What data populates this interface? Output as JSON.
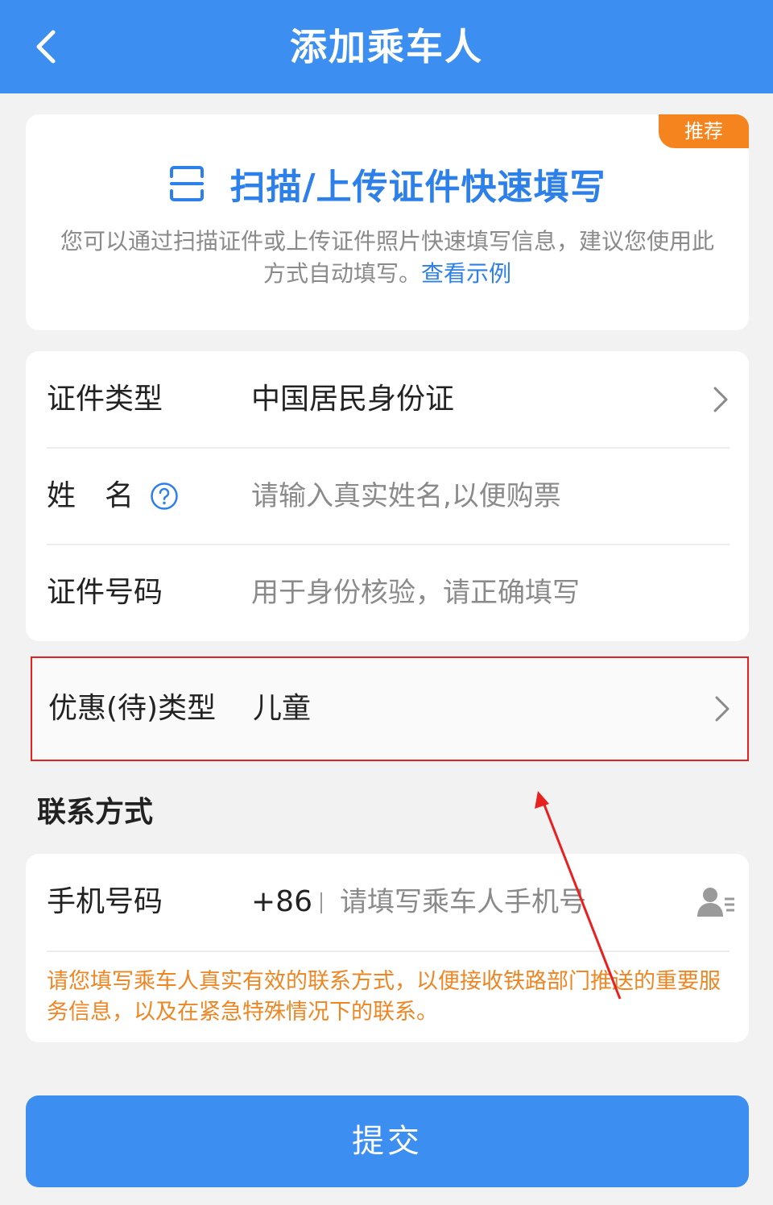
{
  "header": {
    "title": "添加乘车人",
    "back_icon": "chevron-left-icon"
  },
  "scan_card": {
    "badge": "推荐",
    "icon": "scan-frame-icon",
    "title": "扫描/上传证件快速填写",
    "description": "您可以通过扫描证件或上传证件照片快速填写信息，建议您使用此方式自动填写。",
    "link": "查看示例"
  },
  "form": {
    "id_type": {
      "label": "证件类型",
      "value": "中国居民身份证"
    },
    "name": {
      "label": "姓　名",
      "placeholder": "请输入真实姓名,以便购票",
      "help_icon": "question-circle-icon"
    },
    "id_number": {
      "label": "证件号码",
      "placeholder": "用于身份核验，请正确填写"
    }
  },
  "discount": {
    "label": "优惠(待)类型",
    "value": "儿童"
  },
  "contact": {
    "section_title": "联系方式",
    "phone_label": "手机号码",
    "country_code": "+86",
    "phone_placeholder": "请填写乘车人手机号",
    "contact_icon": "contact-book-icon",
    "notice": "请您填写乘车人真实有效的联系方式，以便接收铁路部门推送的重要服务信息，以及在紧急特殊情况下的联系。"
  },
  "submit_label": "提交",
  "colors": {
    "primary": "#3d8ef1",
    "link": "#2d80ea",
    "badge": "#f5841f",
    "notice": "#ef8624",
    "highlight_border": "#e8201f"
  }
}
